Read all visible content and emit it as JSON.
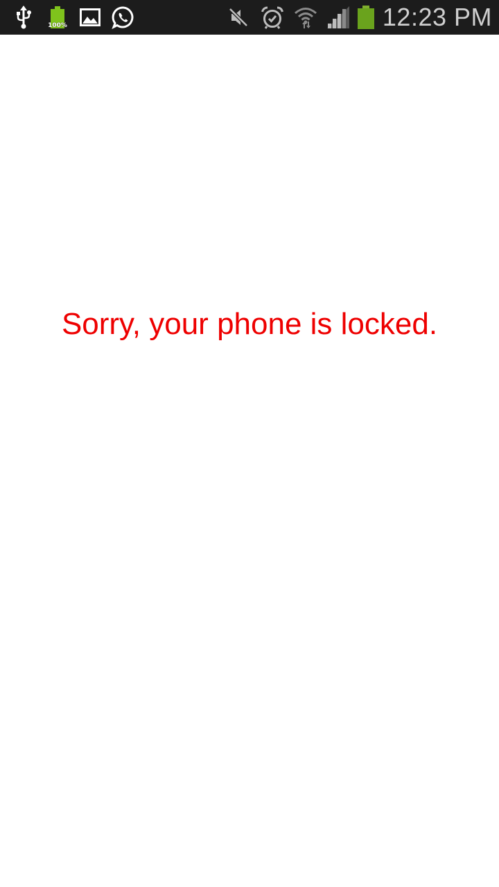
{
  "status_bar": {
    "left_icons": [
      "usb-icon",
      "battery-full-notification-icon",
      "gallery-icon",
      "whatsapp-icon"
    ],
    "right_icons": [
      "mute-icon",
      "alarm-icon",
      "wifi-icon",
      "signal-icon",
      "battery-icon"
    ],
    "battery_notification_text": "100%",
    "time": "12:23 PM",
    "colors": {
      "background": "#1c1c1c",
      "icon": "#ffffff",
      "battery_green": "#7fc31c",
      "clock": "#cfcfcf"
    }
  },
  "main": {
    "message": "Sorry, your phone is locked.",
    "message_color": "#ee0000",
    "background": "#ffffff"
  }
}
